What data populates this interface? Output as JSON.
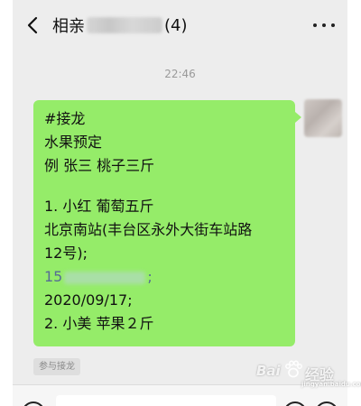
{
  "header": {
    "title": "相亲",
    "member_count": "(4)",
    "back_icon": "chevron-left-icon",
    "more_icon": "more-dots-icon"
  },
  "chat": {
    "timestamp": "22:46",
    "message": {
      "lines": [
        "#接龙",
        "水果预定",
        "例 张三 桃子三斤",
        "",
        "1. 小红 葡萄五斤",
        "北京南站(丰台区永外大街车站路",
        "12号);",
        "15",
        "2020/09/17;",
        "2. 小美 苹果２斤"
      ],
      "phone_suffix": ";"
    },
    "join_button_label": "参与接龙"
  },
  "input_bar": {
    "voice_icon": "voice-icon",
    "emoji_icon": "emoji-icon",
    "plus_icon": "plus-icon"
  },
  "watermark": {
    "text_left": "Bai",
    "text_right": "经验",
    "url": "jingyan.baidu.com"
  },
  "colors": {
    "bubble": "#95ec69",
    "background": "#ededed",
    "phone_link": "#576b95"
  }
}
